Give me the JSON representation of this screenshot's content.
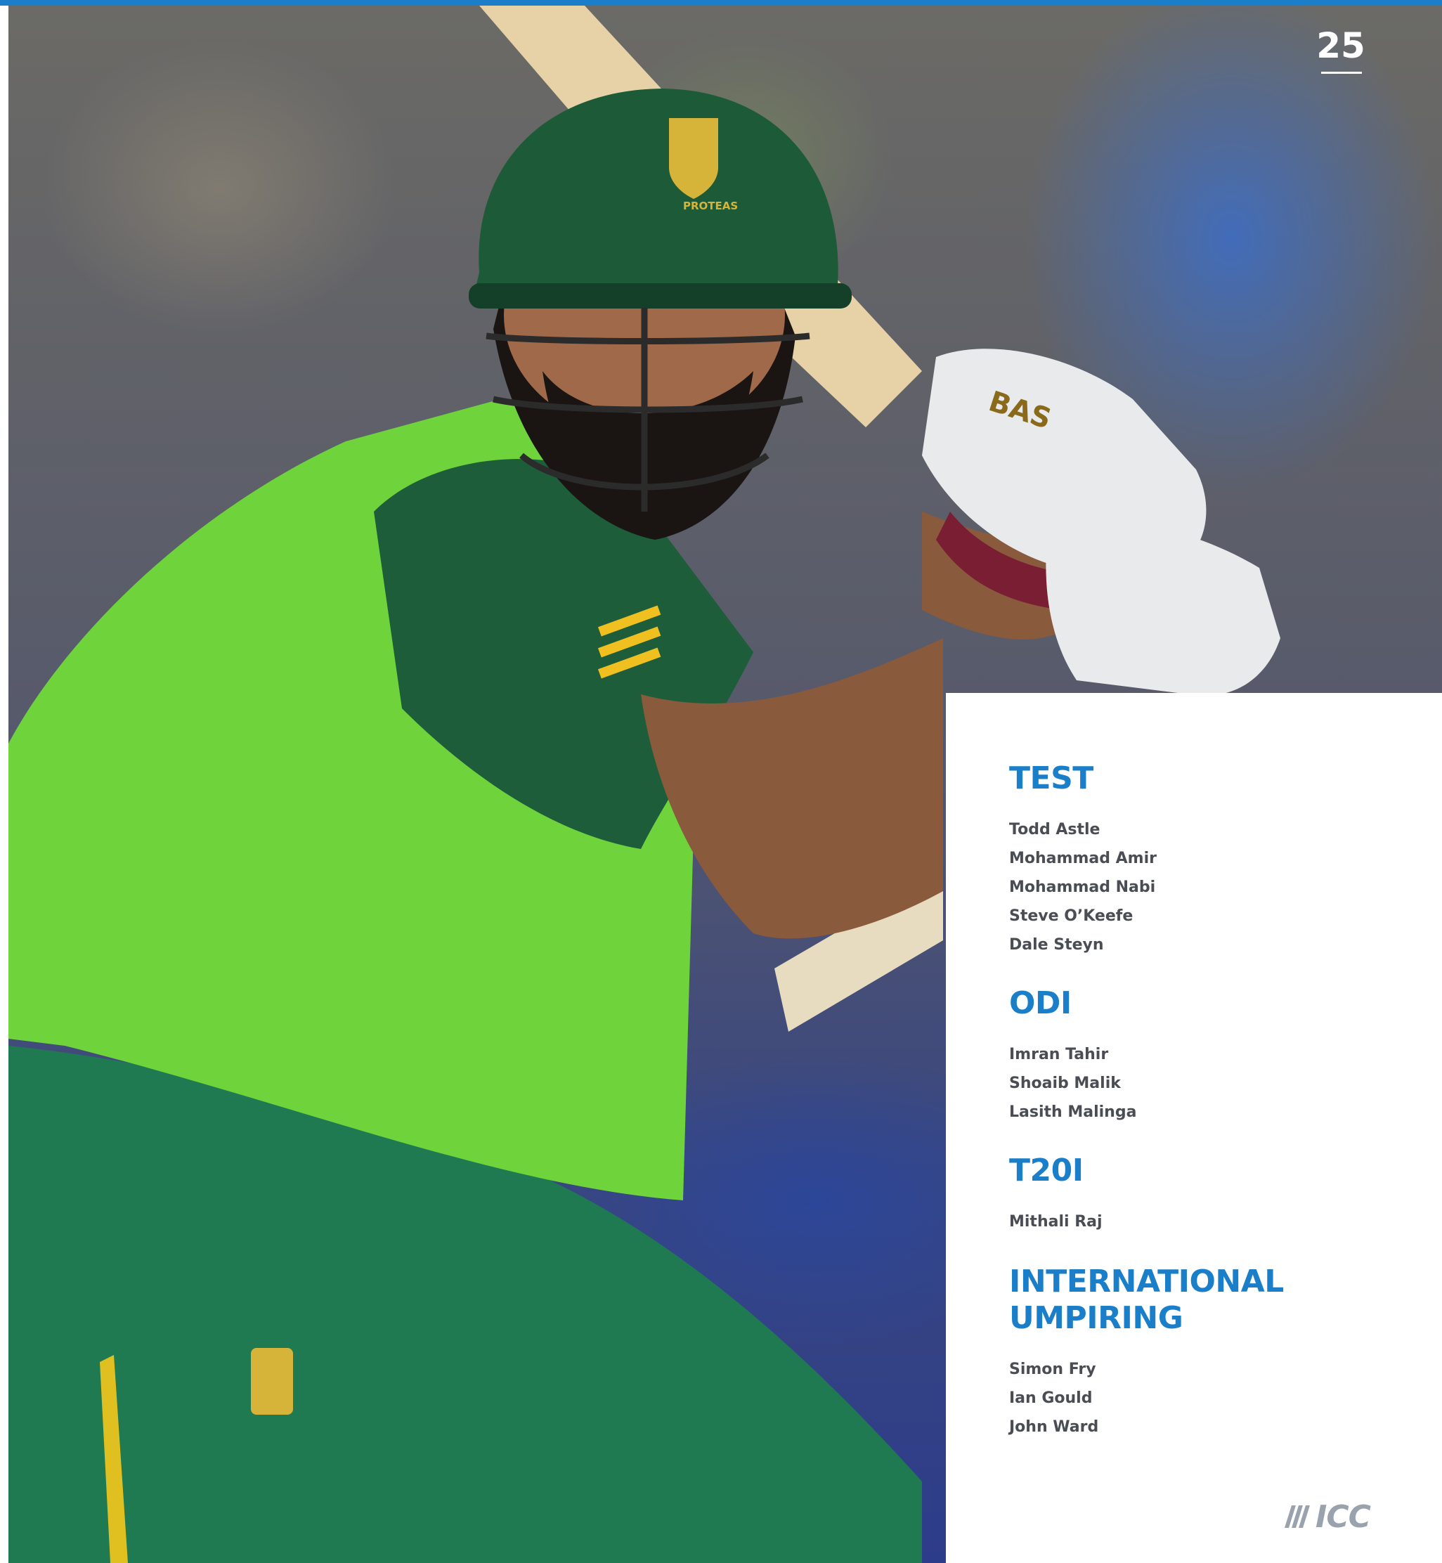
{
  "page": {
    "number": "25"
  },
  "sections": [
    {
      "title": "TEST",
      "names": [
        "Todd Astle",
        "Mohammad Amir",
        "Mohammad Nabi",
        "Steve O’Keefe",
        "Dale Steyn"
      ]
    },
    {
      "title": "ODI",
      "names": [
        "Imran Tahir",
        "Shoaib Malik",
        "Lasith Malinga"
      ]
    },
    {
      "title": "T20I",
      "names": [
        "Mithali Raj"
      ]
    },
    {
      "title": "INTERNATIONAL UMPIRING",
      "names": [
        "Simon Fry",
        "Ian Gould",
        "John Ward"
      ]
    }
  ],
  "logo": {
    "text": "ICC"
  },
  "photo": {
    "helmet_badge": "PROTEAS",
    "glove_brand": "BAS",
    "colors": {
      "shirt": "#6fd43c",
      "sleeve": "#1d5d3a",
      "trousers": "#1f7a52",
      "helmet": "#1c5a38",
      "accent": "#1a7fc8"
    }
  }
}
